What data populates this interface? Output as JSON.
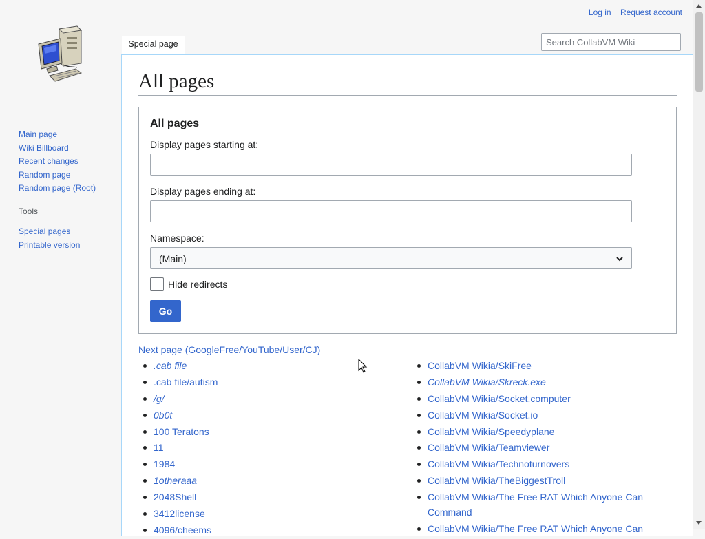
{
  "header": {
    "login": "Log in",
    "request_account": "Request account"
  },
  "logo": {
    "icon": "computer-icon"
  },
  "search": {
    "placeholder": "Search CollabVM Wiki"
  },
  "tabs": [
    {
      "label": "Special page"
    }
  ],
  "sidebar": {
    "nav": [
      {
        "label": "Main page"
      },
      {
        "label": "Wiki Billboard"
      },
      {
        "label": "Recent changes"
      },
      {
        "label": "Random page"
      },
      {
        "label": "Random page (Root)"
      }
    ],
    "tools_heading": "Tools",
    "tools": [
      {
        "label": "Special pages"
      },
      {
        "label": "Printable version"
      }
    ]
  },
  "page": {
    "title": "All pages",
    "form": {
      "legend": "All pages",
      "from_label": "Display pages starting at:",
      "from_value": "",
      "to_label": "Display pages ending at:",
      "to_value": "",
      "namespace_label": "Namespace:",
      "namespace_value": "(Main)",
      "hide_redirects_label": "Hide redirects",
      "go_label": "Go"
    },
    "next_page": "Next page (GoogleFree/YouTube/User/CJ)",
    "column1": [
      {
        "label": ".cab file",
        "italic": true
      },
      {
        "label": ".cab file/autism",
        "italic": false
      },
      {
        "label": "/g/",
        "italic": true
      },
      {
        "label": "0b0t",
        "italic": true
      },
      {
        "label": "100 Teratons",
        "italic": false
      },
      {
        "label": "11",
        "italic": false
      },
      {
        "label": "1984",
        "italic": false
      },
      {
        "label": "1otheraaa",
        "italic": true
      },
      {
        "label": "2048Shell",
        "italic": false
      },
      {
        "label": "3412license",
        "italic": false
      },
      {
        "label": "4096/cheems",
        "italic": false
      }
    ],
    "column2": [
      {
        "label": "CollabVM Wikia/SkiFree",
        "italic": false
      },
      {
        "label": "CollabVM Wikia/Skreck.exe",
        "italic": true
      },
      {
        "label": "CollabVM Wikia/Socket.computer",
        "italic": false
      },
      {
        "label": "CollabVM Wikia/Socket.io",
        "italic": false
      },
      {
        "label": "CollabVM Wikia/Speedyplane",
        "italic": false
      },
      {
        "label": "CollabVM Wikia/Teamviewer",
        "italic": false
      },
      {
        "label": "CollabVM Wikia/Technoturnovers",
        "italic": false
      },
      {
        "label": "CollabVM Wikia/TheBiggestTroll",
        "italic": false
      },
      {
        "label": "CollabVM Wikia/The Free RAT Which Anyone Can Command",
        "italic": false
      },
      {
        "label": "CollabVM Wikia/The Free RAT Which Anyone Can",
        "italic": false
      }
    ]
  },
  "colors": {
    "link": "#3366cc",
    "button": "#3366cc",
    "background": "#f6f6f6",
    "content_border": "#a7d7f9"
  }
}
